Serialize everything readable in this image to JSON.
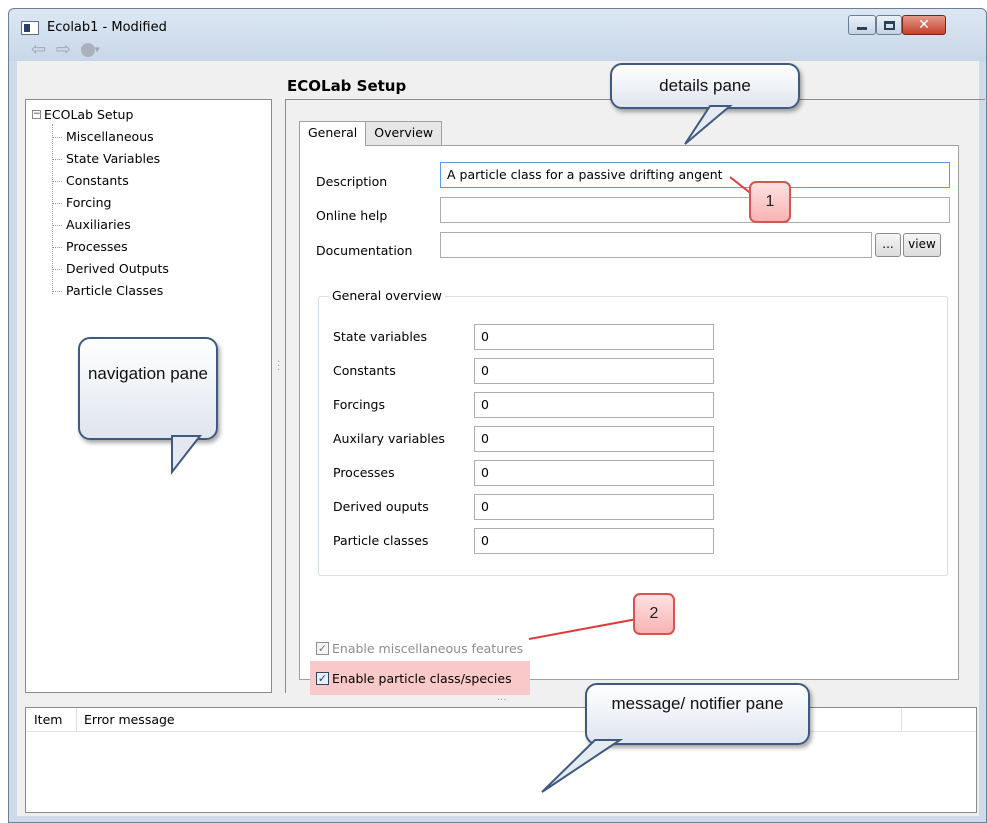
{
  "window": {
    "title": "Ecolab1 - Modified",
    "close_glyph": "✕"
  },
  "toolbar": {
    "back_glyph": "⇦",
    "forward_glyph": "⇨",
    "caret_glyph": "▾"
  },
  "navigation": {
    "root_label": "ECOLab Setup",
    "expander": "−",
    "items": [
      "Miscellaneous",
      "State Variables",
      "Constants",
      "Forcing",
      "Auxiliaries",
      "Processes",
      "Derived Outputs",
      "Particle Classes"
    ]
  },
  "details": {
    "title": "ECOLab Setup",
    "tabs": [
      "General",
      "Overview"
    ],
    "description_label": "Description",
    "description_value": "A particle class for a passive drifting angent",
    "online_help_label": "Online help",
    "online_help_value": "",
    "documentation_label": "Documentation",
    "documentation_value": "",
    "browse_label": "...",
    "view_label": "view",
    "group_title": "General overview",
    "overview": [
      {
        "label": "State variables",
        "value": "0"
      },
      {
        "label": "Constants",
        "value": "0"
      },
      {
        "label": "Forcings",
        "value": "0"
      },
      {
        "label": "Auxilary variables",
        "value": "0"
      },
      {
        "label": "Processes",
        "value": "0"
      },
      {
        "label": "Derived ouputs",
        "value": "0"
      },
      {
        "label": "Particle classes",
        "value": "0"
      }
    ],
    "misc_checkbox": {
      "label": "Enable miscellaneous features",
      "checked": true,
      "enabled": false
    },
    "particle_checkbox": {
      "label": "Enable particle class/species",
      "checked": true,
      "enabled": true
    },
    "check_glyph": "✓"
  },
  "messages": {
    "col_item": "Item",
    "col_error": "Error message"
  },
  "callouts": {
    "details": "details pane",
    "navigation": "navigation pane",
    "message": "message/ notifier pane",
    "badge1": "1",
    "badge2": "2"
  },
  "colors": {
    "highlight": "#f9c9c9",
    "badge_border": "#d9534f",
    "callout_border": "#3f5a7f"
  }
}
